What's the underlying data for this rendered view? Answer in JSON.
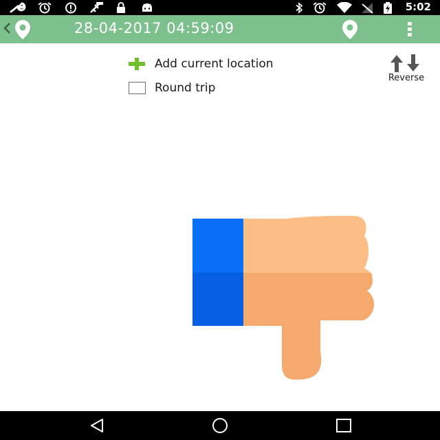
{
  "status_bar": {
    "time": "5:02",
    "left_icons": [
      "wrench-icon",
      "alarm-icon",
      "info-icon",
      "gps-off-icon",
      "lock-icon",
      "android-icon"
    ],
    "right_icons": [
      "bluetooth-icon",
      "alarm-icon",
      "wifi-icon",
      "no-signal-icon",
      "battery-charging-icon"
    ]
  },
  "app_bar": {
    "title": "28-04-2017 04:59:09",
    "color": "#7dc08d"
  },
  "options": {
    "add_location_label": "Add current location",
    "round_trip_label": "Round trip",
    "round_trip_checked": false,
    "reverse_label": "Reverse"
  },
  "illustration": {
    "icon": "thumbs-down-icon",
    "colors": {
      "cuff_top": "#0a6ff9",
      "cuff_bottom": "#0660e4",
      "skin_light": "#fcbd87",
      "skin_dark": "#f5a96d"
    }
  },
  "nav_bar": {
    "buttons": [
      "back-icon",
      "home-icon",
      "recents-icon"
    ]
  }
}
